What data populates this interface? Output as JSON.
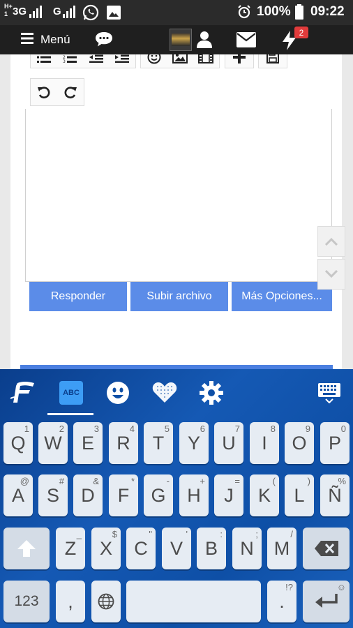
{
  "status_bar": {
    "sim1": "3G",
    "sim2": "G",
    "battery": "100%",
    "time": "09:22"
  },
  "navbar": {
    "menu_label": "Menú",
    "notification_count": "2"
  },
  "actions": {
    "reply": "Responder",
    "upload": "Subir archivo",
    "more": "Más Opciones..."
  },
  "keyboard": {
    "row1": [
      {
        "main": "Q",
        "sub": "1"
      },
      {
        "main": "W",
        "sub": "2"
      },
      {
        "main": "E",
        "sub": "3"
      },
      {
        "main": "R",
        "sub": "4"
      },
      {
        "main": "T",
        "sub": "5"
      },
      {
        "main": "Y",
        "sub": "6"
      },
      {
        "main": "U",
        "sub": "7"
      },
      {
        "main": "I",
        "sub": "8"
      },
      {
        "main": "O",
        "sub": "9"
      },
      {
        "main": "P",
        "sub": "0"
      }
    ],
    "row2": [
      {
        "main": "A",
        "sub": "@"
      },
      {
        "main": "S",
        "sub": "#"
      },
      {
        "main": "D",
        "sub": "&"
      },
      {
        "main": "F",
        "sub": "*"
      },
      {
        "main": "G",
        "sub": "-"
      },
      {
        "main": "H",
        "sub": "+"
      },
      {
        "main": "J",
        "sub": "="
      },
      {
        "main": "K",
        "sub": "("
      },
      {
        "main": "L",
        "sub": ")"
      },
      {
        "main": "Ñ",
        "sub": "%"
      }
    ],
    "row3": [
      {
        "main": "Z",
        "sub": "_"
      },
      {
        "main": "X",
        "sub": "$"
      },
      {
        "main": "C",
        "sub": "\""
      },
      {
        "main": "V",
        "sub": "'"
      },
      {
        "main": "B",
        "sub": ":"
      },
      {
        "main": "N",
        "sub": ";"
      },
      {
        "main": "M",
        "sub": "/"
      }
    ],
    "num_label": "123",
    "comma": ",",
    "period": ".",
    "period_sub": "!?",
    "abc_label": "ABC"
  },
  "colors": {
    "accent": "#5b8ce8",
    "keyboard_bg": "#0e4fa6",
    "badge": "#e23b3b"
  }
}
